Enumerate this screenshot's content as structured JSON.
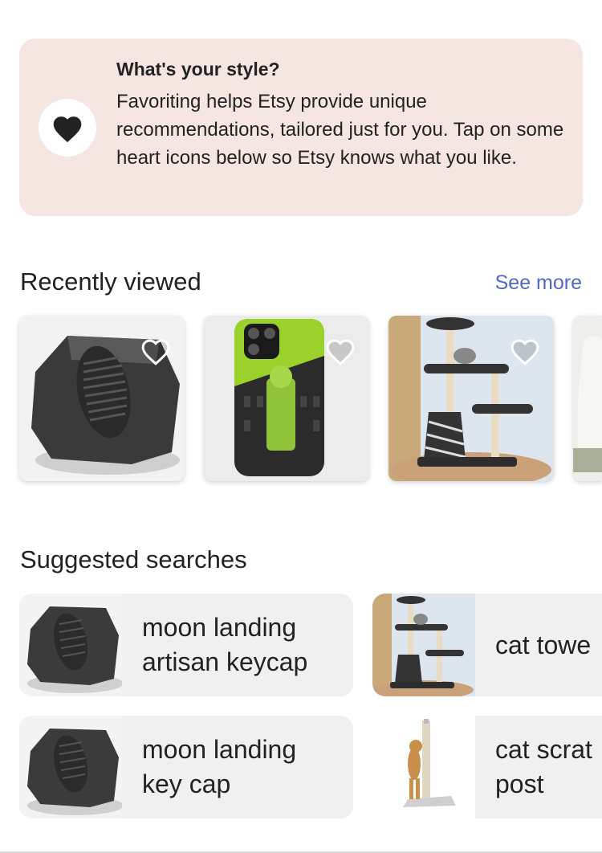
{
  "promo": {
    "heading": "What's your style?",
    "body": "Favoriting helps Etsy provide unique recommendations, tailored just for you. Tap on some heart icons below so Etsy knows what you like.",
    "icon": "heart-icon"
  },
  "recently_viewed": {
    "title": "Recently viewed",
    "see_more": "See more",
    "items": [
      {
        "image": "moon-landing-keycap",
        "favorite_icon": "heart-outline-icon"
      },
      {
        "image": "phone-case",
        "favorite_icon": "heart-outline-icon"
      },
      {
        "image": "cat-tree",
        "favorite_icon": "heart-outline-icon"
      },
      {
        "image": "armchair-partial"
      }
    ]
  },
  "suggested_searches": {
    "title": "Suggested searches",
    "items": [
      {
        "line1": "moon landing",
        "line2": "artisan keycap",
        "image": "moon-landing-keycap"
      },
      {
        "line1": "cat towe",
        "line2": "",
        "image": "cat-tree"
      },
      {
        "line1": "moon landing",
        "line2": "key cap",
        "image": "moon-landing-keycap"
      },
      {
        "line1": "cat scrat",
        "line2": "post",
        "image": "cat-scratching-post"
      }
    ]
  },
  "colors": {
    "promo_bg": "#f5e6e1",
    "link": "#4d6bc6",
    "card_bg": "#f0f0f0",
    "text": "#222222"
  }
}
